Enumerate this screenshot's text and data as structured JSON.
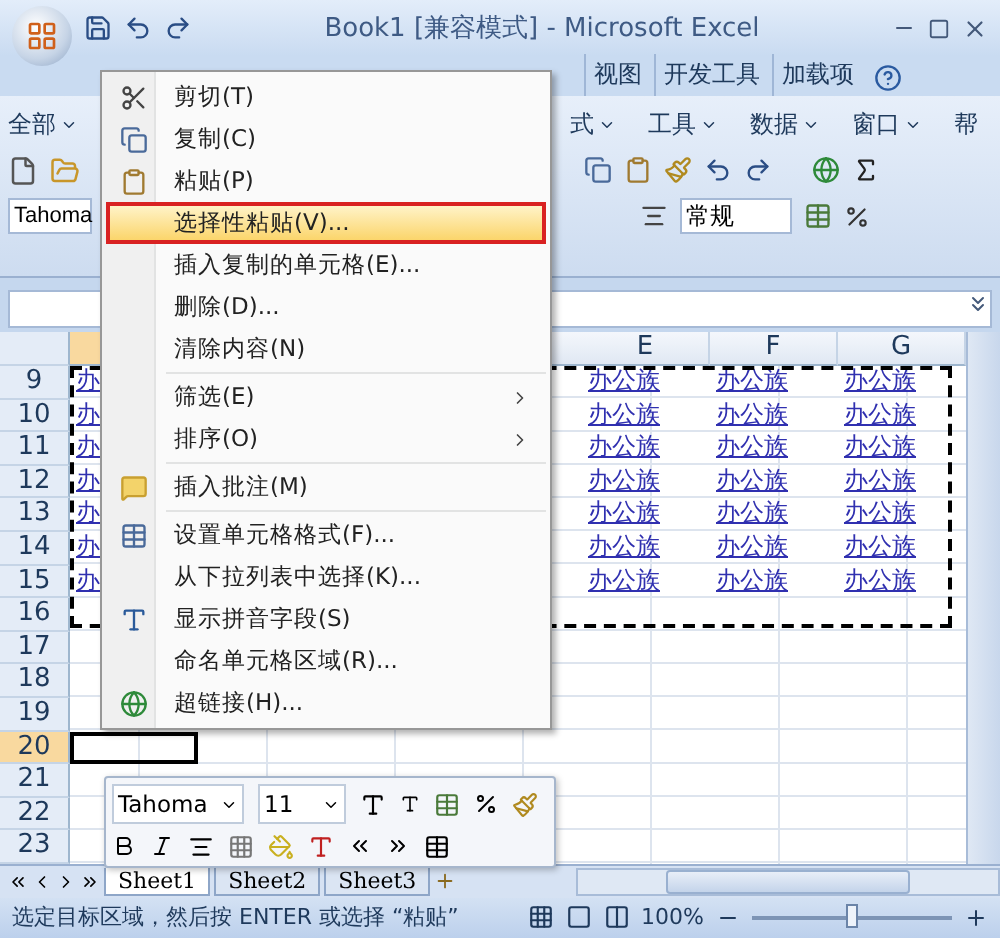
{
  "window": {
    "title": "Book1  [兼容模式]  - Microsoft Excel"
  },
  "ribbon_tabs": [
    {
      "label": "视图",
      "selected": false
    },
    {
      "label": "开发工具",
      "selected": false
    },
    {
      "label": "加载项",
      "selected": false
    }
  ],
  "menus_left": [
    "全部"
  ],
  "menus_right": [
    {
      "label": "式",
      "dropdown": true
    },
    {
      "label": "工具",
      "dropdown": true
    },
    {
      "label": "数据",
      "dropdown": true
    },
    {
      "label": "窗口",
      "dropdown": true
    },
    {
      "label": "帮",
      "dropdown": false
    }
  ],
  "font_box": {
    "value": "Tahoma"
  },
  "number_format": {
    "value": "常规"
  },
  "sheet": {
    "columns": [
      {
        "selected": true
      },
      {
        "label": "E",
        "selected": false
      },
      {
        "label": "F",
        "selected": false
      },
      {
        "label": "G",
        "selected": false
      }
    ],
    "rows": [
      {
        "header": "9",
        "selected": false,
        "cells": [
          "办",
          null,
          null,
          null,
          "办公族",
          "办公族",
          "办公族"
        ]
      },
      {
        "header": "10",
        "selected": false,
        "cells": [
          "办",
          null,
          null,
          null,
          "办公族",
          "办公族",
          "办公族"
        ]
      },
      {
        "header": "11",
        "selected": false,
        "cells": [
          "办",
          null,
          null,
          null,
          "办公族",
          "办公族",
          "办公族"
        ]
      },
      {
        "header": "12",
        "selected": false,
        "cells": [
          "办",
          null,
          null,
          null,
          "办公族",
          "办公族",
          "办公族"
        ]
      },
      {
        "header": "13",
        "selected": false,
        "cells": [
          "办",
          null,
          null,
          null,
          "办公族",
          "办公族",
          "办公族"
        ]
      },
      {
        "header": "14",
        "selected": false,
        "cells": [
          "办",
          null,
          null,
          null,
          "办公族",
          "办公族",
          "办公族"
        ]
      },
      {
        "header": "15",
        "selected": false,
        "cells": [
          "办",
          null,
          null,
          null,
          "办公族",
          "办公族",
          "办公族"
        ]
      },
      {
        "header": "16",
        "selected": false
      },
      {
        "header": "17",
        "selected": false
      },
      {
        "header": "18",
        "selected": false
      },
      {
        "header": "19",
        "selected": false
      },
      {
        "header": "20",
        "selected": true
      },
      {
        "header": "21",
        "selected": false
      },
      {
        "header": "22",
        "selected": false
      },
      {
        "header": "23",
        "selected": false
      }
    ]
  },
  "context_menu": {
    "groups": [
      [
        {
          "label": "剪切(T)",
          "kind": "cut",
          "selected": false,
          "submenu": false
        },
        {
          "label": "复制(C)",
          "kind": "copy",
          "selected": false,
          "submenu": false
        },
        {
          "label": "粘贴(P)",
          "kind": "paste",
          "selected": false,
          "submenu": false
        },
        {
          "label": "选择性粘贴(V)...",
          "selected": true,
          "submenu": false
        },
        {
          "label": "插入复制的单元格(E)...",
          "selected": false,
          "submenu": false
        },
        {
          "label": "删除(D)...",
          "selected": false,
          "submenu": false
        },
        {
          "label": "清除内容(N)",
          "selected": false,
          "submenu": false
        }
      ],
      [
        {
          "label": "筛选(E)",
          "selected": false,
          "submenu": true
        },
        {
          "label": "排序(O)",
          "selected": false,
          "submenu": true
        }
      ],
      [
        {
          "label": "插入批注(M)",
          "kind": "comment",
          "selected": false,
          "submenu": false
        }
      ],
      [
        {
          "label": "设置单元格格式(F)...",
          "kind": "format",
          "selected": false,
          "submenu": false
        },
        {
          "label": "从下拉列表中选择(K)...",
          "selected": false,
          "submenu": false
        },
        {
          "label": "显示拼音字段(S)",
          "kind": "pinyin",
          "selected": false,
          "submenu": false
        },
        {
          "label": "命名单元格区域(R)...",
          "selected": false,
          "submenu": false
        },
        {
          "label": "超链接(H)...",
          "kind": "link",
          "selected": false,
          "submenu": false
        }
      ]
    ]
  },
  "mini_toolbar": {
    "font": "Tahoma",
    "size": "11"
  },
  "sheet_tabs": [
    {
      "label": "Sheet1",
      "selected": true
    },
    {
      "label": "Sheet2",
      "selected": false
    },
    {
      "label": "Sheet3",
      "selected": false
    }
  ],
  "status_bar": {
    "message": "选定目标区域，然后按 ENTER 或选择 “粘贴”",
    "zoom": "100%",
    "zoom_slider": {
      "level": 0.5
    }
  }
}
